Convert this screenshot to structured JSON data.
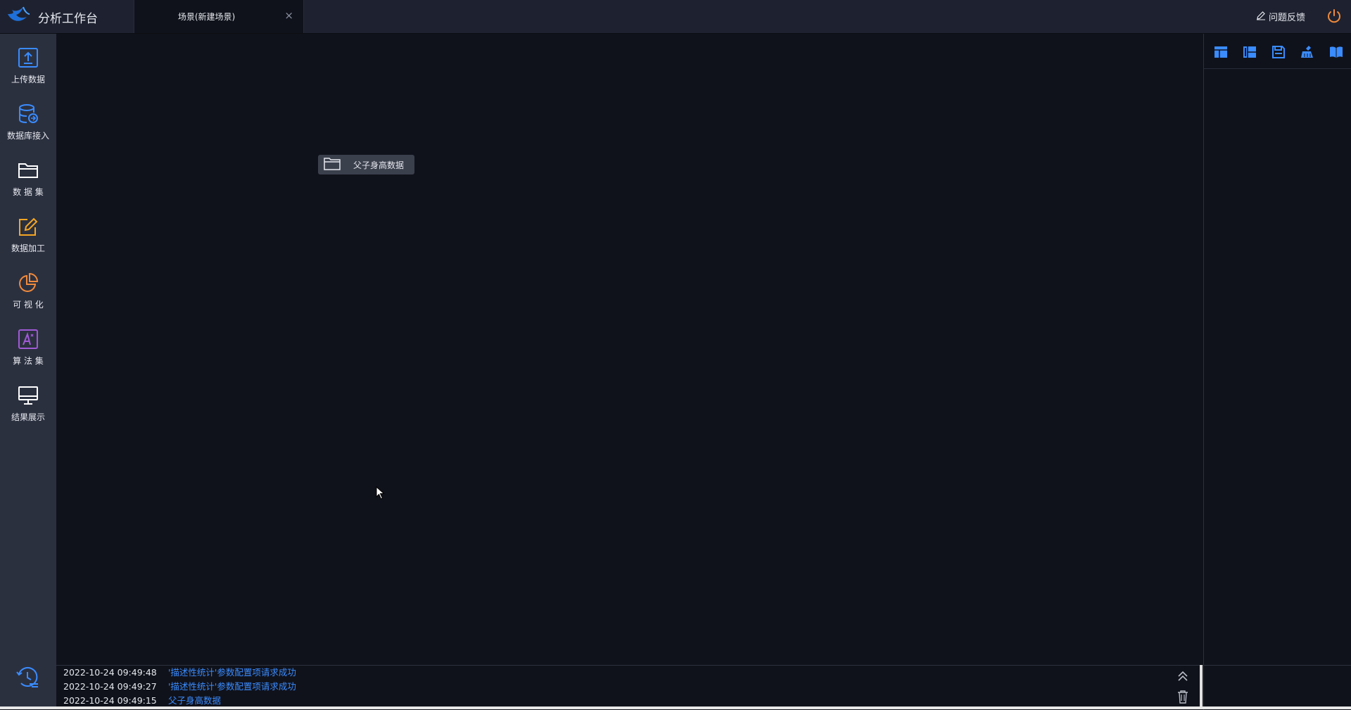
{
  "header": {
    "app_title": "分析工作台",
    "logo_icon": "bird-logo-icon",
    "active_tab": {
      "label": "场景(新建场景)",
      "close_glyph": "×"
    },
    "feedback_label": "问题反馈",
    "feedback_icon": "edit-icon",
    "power_icon": "power-icon"
  },
  "sidebar": {
    "items": [
      {
        "label": "上传数据",
        "icon": "upload-icon",
        "color": "#3a8cff"
      },
      {
        "label": "数据库接入",
        "icon": "database-connect-icon",
        "color": "#3a8cff"
      },
      {
        "label": "数 据 集",
        "icon": "folder-icon",
        "color": "#ffffff"
      },
      {
        "label": "数据加工",
        "icon": "edit-square-icon",
        "color": "#f5a623"
      },
      {
        "label": "可 视 化",
        "icon": "pie-chart-icon",
        "color": "#f08a3c"
      },
      {
        "label": "算 法 集",
        "icon": "algorithm-icon",
        "color": "#a05ad6"
      },
      {
        "label": "结果展示",
        "icon": "monitor-icon",
        "color": "#ffffff"
      }
    ],
    "history_icon": "history-icon"
  },
  "canvas": {
    "node": {
      "label": "父子身高数据",
      "icon": "folder-icon"
    }
  },
  "right_panel": {
    "tools": [
      {
        "icon": "layout-icon"
      },
      {
        "icon": "layout-split-icon"
      },
      {
        "icon": "save-icon"
      },
      {
        "icon": "clean-brush-icon"
      },
      {
        "icon": "book-icon"
      }
    ]
  },
  "log": {
    "entries": [
      {
        "time": "2022-10-24 09:49:48",
        "message": "'描述性统计'参数配置项请求成功"
      },
      {
        "time": "2022-10-24 09:49:27",
        "message": "'描述性统计'参数配置项请求成功"
      },
      {
        "time": "2022-10-24 09:49:15",
        "message": "父子身高数据"
      }
    ],
    "collapse_icon": "double-chevron-up-icon",
    "clear_icon": "trash-icon"
  },
  "colors": {
    "accent": "#3a8cff",
    "warning": "#f08a3c",
    "background": "#10121b",
    "sidebar": "#2b303f"
  }
}
